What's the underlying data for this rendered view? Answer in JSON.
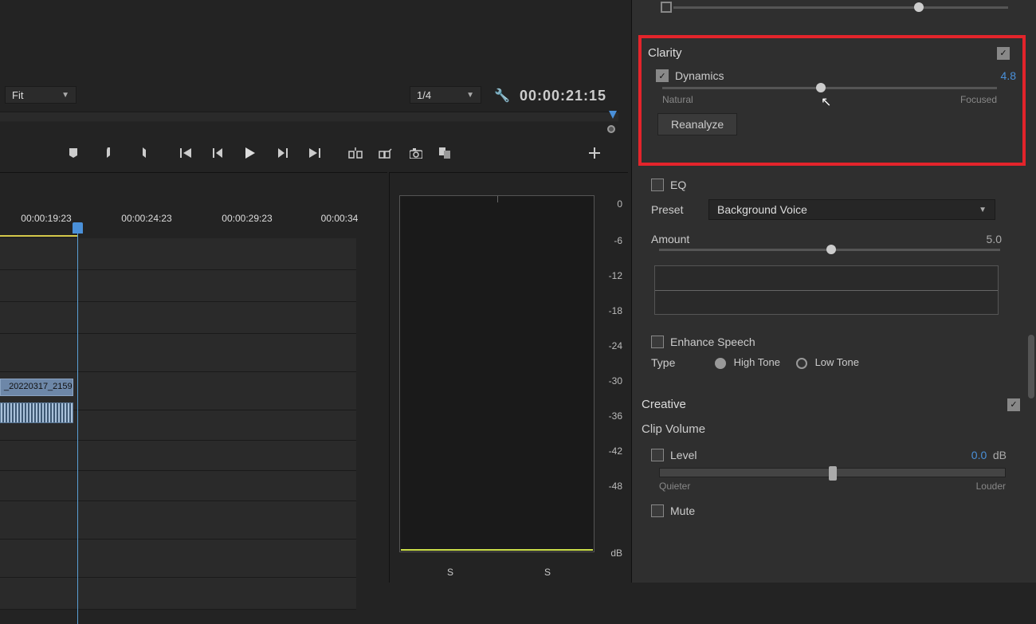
{
  "monitor": {
    "fit_label": "Fit",
    "resolution_label": "1/4",
    "timecode": "00:00:21:15"
  },
  "timeline": {
    "labels": [
      "00:00:19:23",
      "00:00:24:23",
      "00:00:29:23",
      "00:00:34"
    ],
    "clip_name": "_20220317_2159"
  },
  "meter": {
    "scale": [
      "0",
      "-6",
      "-12",
      "-18",
      "-24",
      "-30",
      "-36",
      "-42",
      "-48"
    ],
    "unit": "dB",
    "solo": "S"
  },
  "clarity": {
    "title": "Clarity",
    "dynamics_label": "Dynamics",
    "dynamics_value": "4.8",
    "slider_left": "Natural",
    "slider_right": "Focused",
    "reanalyze": "Reanalyze"
  },
  "eq": {
    "label": "EQ",
    "preset_label": "Preset",
    "preset_value": "Background Voice",
    "amount_label": "Amount",
    "amount_value": "5.0"
  },
  "enhance": {
    "label": "Enhance Speech",
    "type_label": "Type",
    "high": "High Tone",
    "low": "Low Tone"
  },
  "creative": {
    "title": "Creative"
  },
  "clip_volume": {
    "title": "Clip Volume",
    "level_label": "Level",
    "level_value": "0.0",
    "unit": "dB",
    "quieter": "Quieter",
    "louder": "Louder",
    "mute": "Mute"
  }
}
